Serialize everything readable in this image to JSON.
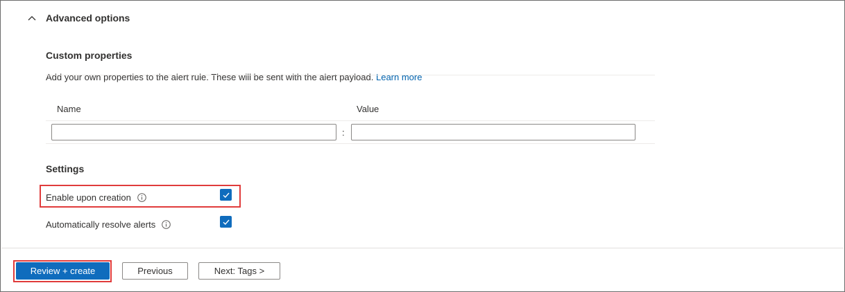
{
  "advanced": {
    "title": "Advanced options"
  },
  "custom_properties": {
    "title": "Custom properties",
    "description": "Add your own properties to the alert rule. These will be sent with the alert payload.",
    "learn_more": "Learn more",
    "name_header": "Name",
    "value_header": "Value",
    "separator": ":",
    "name_value": "",
    "value_value": ""
  },
  "settings": {
    "title": "Settings",
    "enable_label": "Enable upon creation",
    "enable_checked": true,
    "resolve_label": "Automatically resolve alerts",
    "resolve_checked": true
  },
  "footer": {
    "review_create": "Review + create",
    "previous": "Previous",
    "next": "Next: Tags >"
  },
  "colors": {
    "accent": "#0f6cbd",
    "link": "#0062ad",
    "highlight": "#e03b3b"
  }
}
